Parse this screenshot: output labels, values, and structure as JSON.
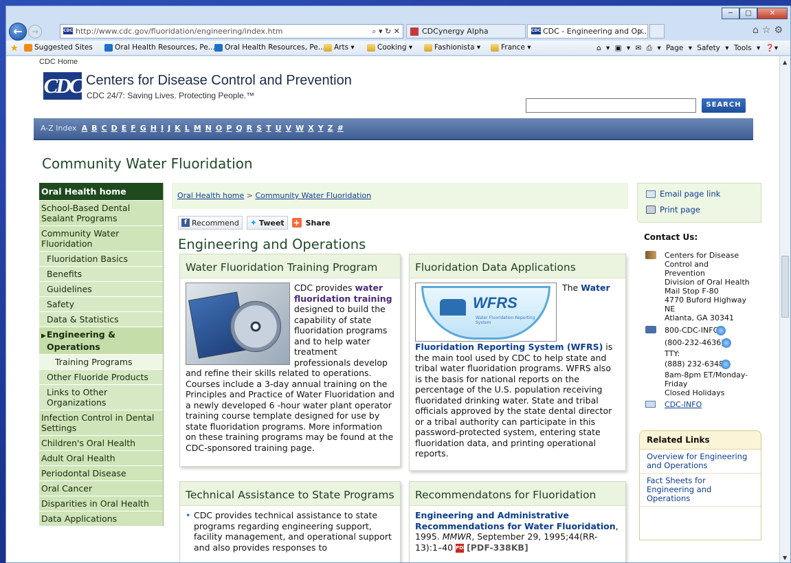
{
  "browser": {
    "address": "http://www.cdc.gov/fluoridation/engineering/index.htm",
    "address_host": "www.cdc.gov",
    "address_tools": "⌕ ▾ ↻ ✕",
    "tabs": [
      "CDCynergy Alpha",
      "CDC - Engineering and Op..."
    ],
    "favorites": [
      "Suggested Sites",
      "Oral Health Resources, Pe...",
      "Oral Health Resources, Pe...",
      "Arts ▾",
      "Cooking ▾",
      "Fashionista ▾",
      "France ▾"
    ],
    "commands": "⌂ ▾ ▣ ▾ ✉ ⎙ ▾ Page ▾ Safety ▾ Tools ▾ ❓▾"
  },
  "header": {
    "cdc_home": "CDC Home",
    "logo": "CDC",
    "site_name": "Centers for Disease Control and Prevention",
    "tagline": "CDC 24/7: Saving Lives. Protecting People.™",
    "search_button": "SEARCH",
    "az_label": "A-Z Index",
    "letters": [
      "A",
      "B",
      "C",
      "D",
      "E",
      "F",
      "G",
      "H",
      "I",
      "J",
      "K",
      "L",
      "M",
      "N",
      "O",
      "P",
      "Q",
      "R",
      "S",
      "T",
      "U",
      "V",
      "W",
      "X",
      "Y",
      "Z",
      "#"
    ]
  },
  "page_title": "Community Water Fluoridation",
  "left_nav": [
    {
      "label": "Oral Health home",
      "level": "top"
    },
    {
      "label": "School-Based Dental Sealant Programs",
      "level": "main"
    },
    {
      "label": "Community Water Fluoridation",
      "level": "main"
    },
    {
      "label": "Fluoridation Basics",
      "level": "sub"
    },
    {
      "label": "Benefits",
      "level": "sub"
    },
    {
      "label": "Guidelines",
      "level": "sub"
    },
    {
      "label": "Safety",
      "level": "sub"
    },
    {
      "label": "Data & Statistics",
      "level": "sub"
    },
    {
      "label": "Engineering & Operations",
      "level": "cur"
    },
    {
      "label": "Training Programs",
      "level": "sub2"
    },
    {
      "label": "Other Fluoride Products",
      "level": "sub"
    },
    {
      "label": "Links to Other Organizations",
      "level": "sub"
    },
    {
      "label": "Infection Control in Dental Settings",
      "level": "main"
    },
    {
      "label": "Children's Oral Health",
      "level": "main"
    },
    {
      "label": "Adult Oral Health",
      "level": "main"
    },
    {
      "label": "Periodontal Disease",
      "level": "main"
    },
    {
      "label": "Oral Cancer",
      "level": "main"
    },
    {
      "label": "Disparities in Oral Health",
      "level": "main"
    },
    {
      "label": "Data Applications",
      "level": "main"
    }
  ],
  "breadcrumb": {
    "home": "Oral Health home",
    "sep": " > ",
    "current": "Community Water Fluoridation"
  },
  "social": {
    "recommend": "Recommend",
    "tweet": "Tweet",
    "share": "Share"
  },
  "section_title": "Engineering and Operations",
  "cards": {
    "training": {
      "title": "Water Fluoridation Training Program",
      "text_a": "CDC provides ",
      "link": "water fluoridation training",
      "text_b": " designed to build the capability of state fluoridation programs and to help water treatment professionals develop and refine their skills related to operations. Courses include a 3-day annual training on the Principles and Practice of Water Fluoridation and a newly developed 6 -hour water plant operator training course template designed for use by state fluoridation programs. More information on these training programs may be found at the CDC-sponsored training page."
    },
    "data": {
      "title": "Fluoridation Data Applications",
      "text_a": "The ",
      "link": "Water Fluoridation Reporting System (WFRS)",
      "text_b": " is the main tool used by CDC to help state and tribal water fluoridation programs. WFRS also is the basis for national reports on the percentage of the U.S. population receiving fluoridated drinking water. State and tribal officials approved by the state dental director or a tribal authority can participate in this password-protected system, entering state fluoridation data, and printing operational reports.",
      "logo_text": "WFRS",
      "logo_sub": "Water Fluoridation Reporting System"
    },
    "technical": {
      "title": "Technical Assistance to State Programs",
      "bullet": "CDC provides technical assistance to state programs regarding engineering support, facility management, and operational support and also provides responses to"
    },
    "recommendations": {
      "title": "Recommendatons for Fluoridation",
      "link": "Engineering and Administrative Recommendations for Water Fluoridation",
      "text_a": ", 1995. ",
      "mmwr": "MMWR",
      "text_b": ", September 29, 1995;44(RR-13):1–40 ",
      "pdf": "[PDF-338KB]"
    }
  },
  "right": {
    "email": "Email page link",
    "print": "Print page",
    "contact_title": "Contact Us:",
    "address_lines": [
      "Centers for Disease",
      "Control and",
      "Prevention",
      "Division of Oral Health",
      "Mail Stop F-80",
      "4770 Buford Highway",
      "NE",
      "Atlanta, GA 30341"
    ],
    "phone1": "800-CDC-INFO",
    "phone2": "(800-232-4636)",
    "tty_label": "TTY:",
    "tty": "(888) 232-6348",
    "hours": "8am-8pm ET/Monday-Friday",
    "closed": "Closed Holidays",
    "cdcinfo": "CDC-INFO",
    "related_title": "Related Links",
    "related": [
      "Overview for Engineering and Operations",
      "Fact Sheets for Engineering and Operations"
    ]
  }
}
